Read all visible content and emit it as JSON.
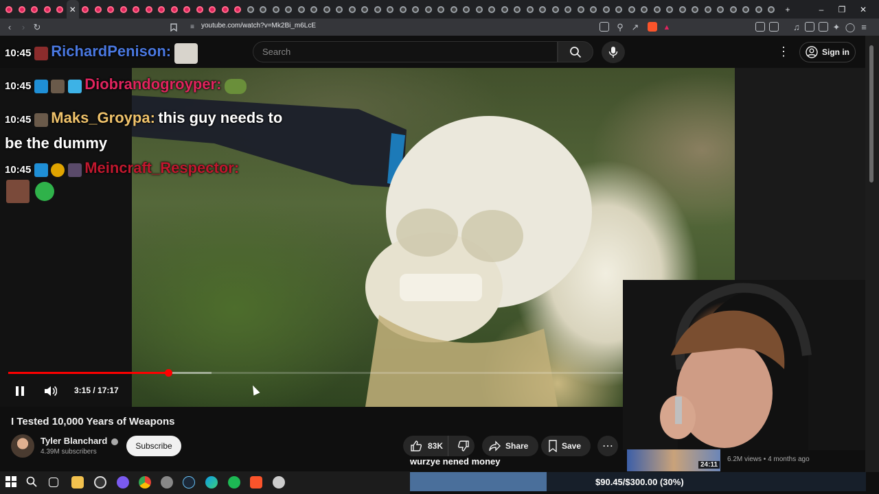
{
  "browser": {
    "url": "youtube.com/watch?v=Mk2Bi_m6LcE",
    "win_controls": {
      "minimize": "–",
      "restore": "❐",
      "close": "✕",
      "new_tab": "+"
    }
  },
  "youtube": {
    "search_placeholder": "Search",
    "sign_in": "Sign in",
    "video": {
      "current_time": "3:15",
      "duration": "17:17",
      "time_display": "3:15 / 17:17",
      "progress_fraction": 0.26,
      "buffer_fraction": 0.33
    },
    "title": "I Tested 10,000 Years of Weapons",
    "channel": {
      "name": "Tyler Blanchard",
      "verified_icon": "check-circle-icon",
      "subscribers": "4.39M subscribers",
      "subscribe_label": "Subscribe"
    },
    "actions": {
      "likes": "83K",
      "share": "Share",
      "save": "Save"
    },
    "recommended": {
      "duration": "24:11",
      "meta": "6.2M views • 4 months ago"
    }
  },
  "chat": [
    {
      "time": "10:45",
      "user": "RichardPenison",
      "user_color": "#4a78e0",
      "message": ""
    },
    {
      "time": "10:45",
      "user": "Diobrandogroyper",
      "user_color": "#e0245e",
      "message": ""
    },
    {
      "time": "10:45",
      "user": "Maks_Groypa",
      "user_color": "#f0c36b",
      "message": "this guy needs to be the dummy"
    },
    {
      "time": "10:45",
      "user": "Meincraft_Respector",
      "user_color": "#c0182e",
      "message": ""
    }
  ],
  "stream_overlay": {
    "donation_message": "wurzye nened money",
    "goal_text": "$90.45/$300.00 (30%)",
    "goal_fraction": 0.3
  },
  "colors": {
    "accent": "#ff0000",
    "background": "#0f0f0f",
    "goal_fill": "#4a6f9b"
  }
}
